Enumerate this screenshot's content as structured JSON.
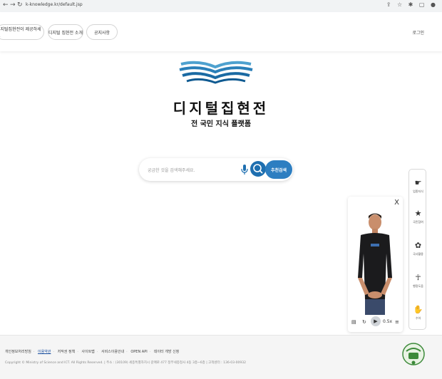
{
  "browser": {
    "url": "k-knowledge.kr/default.jsp"
  },
  "nav": {
    "items": [
      "디지털집현전이 제공하세요",
      "디지털 집현전 소개",
      "공지사항"
    ],
    "login": "로그인"
  },
  "hero": {
    "title": "디지털집현전",
    "subtitle": "전 국민 지식 플랫폼"
  },
  "search": {
    "placeholder": "궁금한 것을 검색해주세요.",
    "recommend": "추천검색"
  },
  "sidebar": {
    "items": [
      {
        "label": "업종지식",
        "icon": "hand-icon"
      },
      {
        "label": "국민참여",
        "icon": "star-icon"
      },
      {
        "label": "국사활용",
        "icon": "flower-icon"
      },
      {
        "label": "행정도움",
        "icon": "person-icon"
      },
      {
        "label": "수어",
        "icon": "sign-hand-icon"
      }
    ]
  },
  "avatar": {
    "close": "X",
    "speed": "0.5x"
  },
  "footer": {
    "links": [
      "개인정보처리방침",
      "이용약관",
      "저작권 정책",
      "사이트맵",
      "서비스이용안내",
      "OPEN API",
      "데이터 개방 신청"
    ],
    "copyright": "Copyright © Ministry of Science and ICT. All Rights Reserved. | 주소 : (30109) 세종특별자치시 갈매로 477 정부세종청사 4동 3층~6층 | 고객센터 : 136-03-00932"
  },
  "colors": {
    "accent": "#1e6fb0",
    "accent_light": "#2d7ec1",
    "logo_blue": "#2a7fb8"
  }
}
